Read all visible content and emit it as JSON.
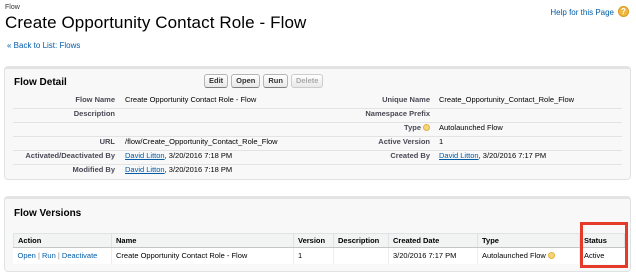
{
  "header": {
    "crumb": "Flow",
    "title": "Create Opportunity Contact Role - Flow",
    "help_link": "Help for this Page",
    "help_icon": "?",
    "back_link": "« Back to List: Flows"
  },
  "detail": {
    "title": "Flow Detail",
    "buttons": {
      "edit": "Edit",
      "open": "Open",
      "run": "Run",
      "delete": "Delete"
    },
    "flow_name_label": "Flow Name",
    "flow_name_value": "Create Opportunity Contact Role - Flow",
    "unique_name_label": "Unique Name",
    "unique_name_value": "Create_Opportunity_Contact_Role_Flow",
    "description_label": "Description",
    "namespace_label": "Namespace Prefix",
    "type_label": "Type",
    "type_value": "Autolaunched Flow",
    "url_label": "URL",
    "url_value": "/flow/Create_Opportunity_Contact_Role_Flow",
    "active_version_label": "Active Version",
    "active_version_value": "1",
    "activated_label": "Activated/Deactivated By",
    "activated_user": "David Litton",
    "activated_date": ", 3/20/2016 7:18 PM",
    "created_label": "Created By",
    "created_user": "David Litton",
    "created_date": ", 3/20/2016 7:17 PM",
    "modified_label": "Modified By",
    "modified_user": "David Litton",
    "modified_date": ", 3/20/2016 7:18 PM"
  },
  "versions": {
    "title": "Flow Versions",
    "columns": {
      "action": "Action",
      "name": "Name",
      "version": "Version",
      "description": "Description",
      "created_date": "Created Date",
      "type": "Type",
      "status": "Status"
    },
    "rows": [
      {
        "action_open": "Open",
        "action_run": "Run",
        "action_deactivate": "Deactivate",
        "separator": "|",
        "name": "Create Opportunity Contact Role - Flow",
        "version": "1",
        "description": "",
        "created_date": "3/20/2016 7:17 PM",
        "type": "Autolaunched Flow",
        "status": "Active"
      }
    ]
  },
  "colors": {
    "link": "#015ba7",
    "highlight": "#e53929",
    "help_icon": "#f2b73f"
  },
  "icons": [
    "help-icon",
    "info-icon"
  ]
}
